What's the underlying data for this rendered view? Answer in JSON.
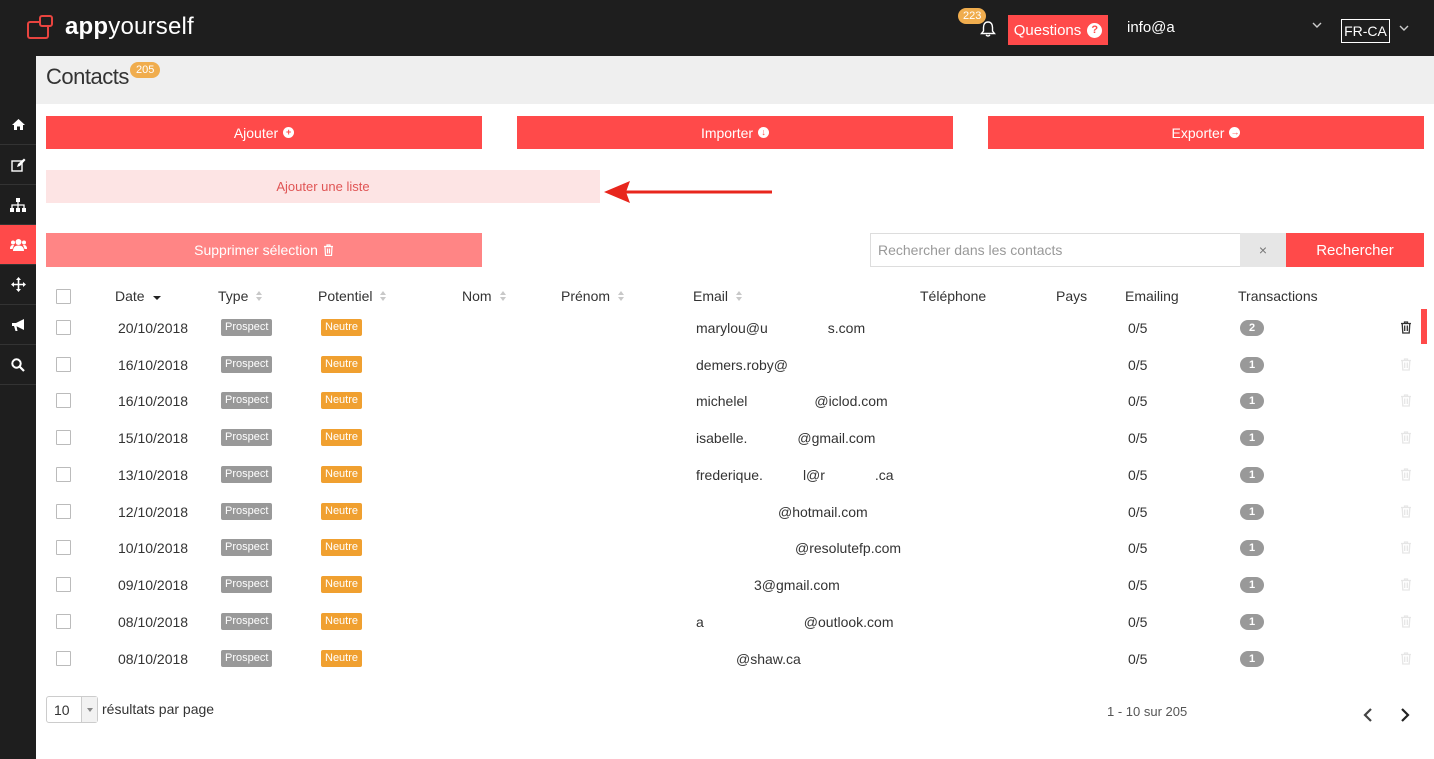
{
  "app": {
    "logo_bold": "app",
    "logo_light": "yourself"
  },
  "topbar": {
    "notifications_count": "223",
    "questions_label": "Questions",
    "questions_icon": "?",
    "user_email": "info@a",
    "language": "FR-CA"
  },
  "sidebar": {
    "items": [
      {
        "icon": "home-icon"
      },
      {
        "icon": "edit-icon"
      },
      {
        "icon": "sitemap-icon"
      },
      {
        "icon": "users-icon",
        "active": true
      },
      {
        "icon": "move-icon"
      },
      {
        "icon": "megaphone-icon"
      },
      {
        "icon": "search-icon"
      }
    ]
  },
  "page": {
    "title": "Contacts",
    "count": "205"
  },
  "actions": {
    "add_label": "Ajouter",
    "import_label": "Importer",
    "export_label": "Exporter",
    "add_list_label": "Ajouter une liste",
    "delete_selection_label": "Supprimer sélection"
  },
  "search": {
    "placeholder": "Rechercher dans les contacts",
    "clear": "×",
    "button": "Rechercher"
  },
  "table": {
    "columns": [
      "Date",
      "Type",
      "Potentiel",
      "Nom",
      "Prénom",
      "Email",
      "Téléphone",
      "Pays",
      "Emailing",
      "Transactions"
    ],
    "rows": [
      {
        "date": "20/10/2018",
        "type": "Prospect",
        "potentiel": "Neutre",
        "email_visible": [
          {
            "text": "marylou@u",
            "mask_after": 60
          },
          {
            "text": "s.com"
          }
        ],
        "emailing": "0/5",
        "transactions": "2"
      },
      {
        "date": "16/10/2018",
        "type": "Prospect",
        "potentiel": "Neutre",
        "email_visible": [
          {
            "text": "demers.roby@"
          }
        ],
        "emailing": "0/5",
        "transactions": "1"
      },
      {
        "date": "16/10/2018",
        "type": "Prospect",
        "potentiel": "Neutre",
        "email_visible": [
          {
            "text": "michelel",
            "mask_after": 67
          },
          {
            "text": "@iclod.com"
          }
        ],
        "emailing": "0/5",
        "transactions": "1"
      },
      {
        "date": "15/10/2018",
        "type": "Prospect",
        "potentiel": "Neutre",
        "email_visible": [
          {
            "text": "isabelle.",
            "mask_after": 50
          },
          {
            "text": "@gmail.com"
          }
        ],
        "emailing": "0/5",
        "transactions": "1"
      },
      {
        "date": "13/10/2018",
        "type": "Prospect",
        "potentiel": "Neutre",
        "email_visible": [
          {
            "text": "frederique.",
            "mask_after": 40
          },
          {
            "text": "l@r",
            "mask_after": 50
          },
          {
            "text": ".ca"
          }
        ],
        "emailing": "0/5",
        "transactions": "1"
      },
      {
        "date": "12/10/2018",
        "type": "Prospect",
        "potentiel": "Neutre",
        "email_visible": [
          {
            "text": "@hotmail.com",
            "offset": 82
          }
        ],
        "emailing": "0/5",
        "transactions": "1"
      },
      {
        "date": "10/10/2018",
        "type": "Prospect",
        "potentiel": "Neutre",
        "email_visible": [
          {
            "text": "@resolutefp.com",
            "offset": 99
          }
        ],
        "emailing": "0/5",
        "transactions": "1"
      },
      {
        "date": "09/10/2018",
        "type": "Prospect",
        "potentiel": "Neutre",
        "email_visible": [
          {
            "text": "3@gmail.com",
            "offset": 58
          }
        ],
        "emailing": "0/5",
        "transactions": "1"
      },
      {
        "date": "08/10/2018",
        "type": "Prospect",
        "potentiel": "Neutre",
        "email_visible": [
          {
            "text": "a",
            "mask_after": 100
          },
          {
            "text": "@outlook.com"
          }
        ],
        "emailing": "0/5",
        "transactions": "1"
      },
      {
        "date": "08/10/2018",
        "type": "Prospect",
        "potentiel": "Neutre",
        "email_visible": [
          {
            "text": "@shaw.ca",
            "offset": 40
          }
        ],
        "emailing": "0/5",
        "transactions": "1"
      }
    ]
  },
  "footer": {
    "page_size": "10",
    "page_size_label": "résultats par page",
    "pager_info": "1 - 10 sur 205"
  },
  "colors": {
    "brand": "#ff4a4a",
    "dark": "#1e1e1e",
    "badge": "#f0ad4e"
  }
}
